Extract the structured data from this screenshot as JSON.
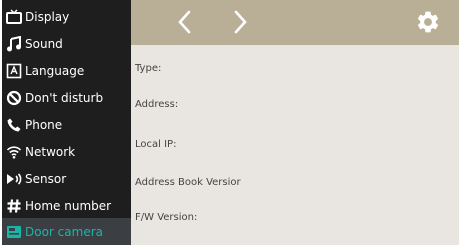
{
  "sidebar": {
    "items": [
      {
        "label": "Display",
        "icon": "tv-icon"
      },
      {
        "label": "Sound",
        "icon": "music-note-icon"
      },
      {
        "label": "Language",
        "icon": "language-icon"
      },
      {
        "label": "Don't disturb",
        "icon": "do-not-disturb-icon"
      },
      {
        "label": "Phone",
        "icon": "phone-icon"
      },
      {
        "label": "Network",
        "icon": "wifi-icon"
      },
      {
        "label": "Sensor",
        "icon": "sensor-icon"
      },
      {
        "label": "Home number",
        "icon": "hash-icon"
      },
      {
        "label": "Door camera",
        "icon": "door-camera-icon"
      }
    ],
    "selected": "Door camera"
  },
  "topbar": {
    "back_icon": "chevron-left-icon",
    "forward_icon": "chevron-right-icon",
    "settings_icon": "gear-icon"
  },
  "info": {
    "type_label": "Type:",
    "address_label": "Address:",
    "local_ip_label": "Local IP:",
    "address_book_version_label": "Address Book Versior",
    "fw_version_label": "F/W Version:"
  },
  "colors": {
    "sidebar_bg": "#1e1e1e",
    "sidebar_selected_bg": "#3b3f43",
    "accent": "#19b6a8",
    "topbar_bg": "#b8af96",
    "content_bg": "#e9e6e1"
  }
}
